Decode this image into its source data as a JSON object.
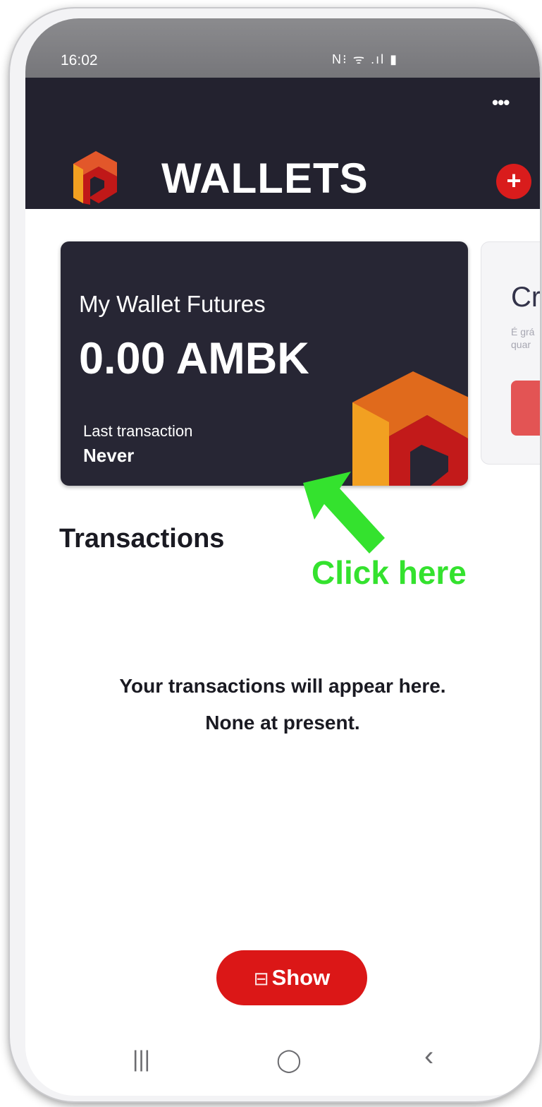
{
  "status_bar": {
    "time": "16:02",
    "icons": "N⁝ ᯤ .ıl ▮"
  },
  "header": {
    "menu_icon": "more-horizontal-icon",
    "title": "WALLETS",
    "add_label": "+"
  },
  "wallet_card": {
    "name": "My Wallet Futures",
    "balance": "0.00 AMBK",
    "last_transaction_label": "Last transaction",
    "last_transaction_value": "Never"
  },
  "next_card": {
    "title": "Cri",
    "subtitle": "É grá quar"
  },
  "transactions": {
    "title": "Transactions",
    "empty_line1": "Your transactions will appear here.",
    "empty_line2": "None at present."
  },
  "annotation": {
    "text": "Click here",
    "color": "#34e22e"
  },
  "show_button": {
    "icon": "scan-icon",
    "label": "Show"
  },
  "nav": {
    "recent": "|||",
    "home": "◯",
    "back": "‹"
  },
  "colors": {
    "header_bg": "#23222f",
    "accent": "#d91c1c",
    "card_bg": "#272634"
  }
}
